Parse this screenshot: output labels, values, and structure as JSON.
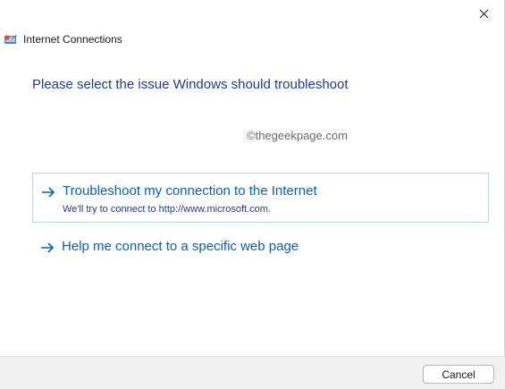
{
  "window": {
    "title": "Internet Connections"
  },
  "main": {
    "heading": "Please select the issue Windows should troubleshoot",
    "watermark": "©thegeekpage.com",
    "options": [
      {
        "label": "Troubleshoot my connection to the Internet",
        "description": "We'll try to connect to http://www.microsoft.com.",
        "icon": "arrow-right-icon",
        "selected": true
      },
      {
        "label": "Help me connect to a specific web page",
        "icon": "arrow-right-icon",
        "selected": false
      }
    ]
  },
  "footer": {
    "cancel_label": "Cancel"
  },
  "colors": {
    "heading": "#1e3c8c",
    "link": "#0a5fb4",
    "selected_border": "#b9d7ea",
    "footer_bg": "#f0f0f0"
  }
}
